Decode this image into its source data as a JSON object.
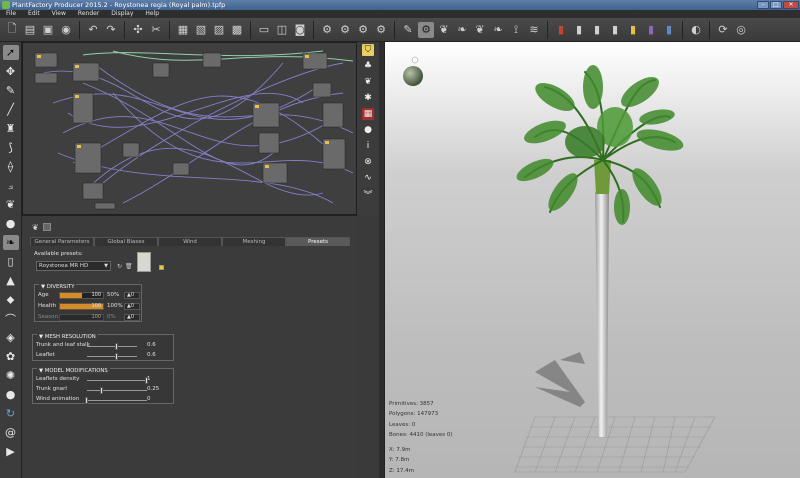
{
  "window": {
    "title": "PlantFactory Producer 2015.2 - Roystonea regia (Royal palm).tpfp",
    "min": "–",
    "max": "□",
    "close": "✕"
  },
  "menu": [
    "File",
    "Edit",
    "View",
    "Render",
    "Display",
    "Help"
  ],
  "panel": {
    "tabs": [
      "General Parameters",
      "Global Biases",
      "Wind",
      "Meshing",
      "Presets"
    ],
    "active_tab": "Presets",
    "presets_label": "Available presets:",
    "preset_value": "Roystonea MR HD",
    "diversity": {
      "title": "DIVERSITY",
      "rows": [
        {
          "label": "Age",
          "value": "50%",
          "max": "100",
          "spin": "0",
          "fill": 0.5,
          "enabled": true
        },
        {
          "label": "Health",
          "value": "100%",
          "max": "100",
          "spin": "0",
          "fill": 1.0,
          "enabled": true
        },
        {
          "label": "Season",
          "value": "0%",
          "max": "100",
          "spin": "0",
          "fill": 0.0,
          "enabled": false
        }
      ]
    },
    "mesh_resolution": {
      "title": "MESH RESOLUTION",
      "rows": [
        {
          "label": "Trunk and leaf stalk",
          "value": "0.6",
          "pos": 0.6
        },
        {
          "label": "Leaflet",
          "value": "0.6",
          "pos": 0.6
        }
      ]
    },
    "model_modifications": {
      "title": "MODEL MODIFICATIONS",
      "rows": [
        {
          "label": "Leaflets density",
          "value": "1",
          "pos": 1.0
        },
        {
          "label": "Trunk gnarl",
          "value": "0.25",
          "pos": 0.25
        },
        {
          "label": "Wind animation",
          "value": "0",
          "pos": 0.0
        }
      ]
    }
  },
  "stats": {
    "primitives": "Primitives: 3857",
    "polygons": "Polygons: 147973",
    "leaves": "Leaves: 0",
    "bones": "Bones: 4410 (leaves 0)"
  },
  "coords": {
    "x": "X: 7.9m",
    "y": "Y: 7.8m",
    "z": "Z: 17.4m"
  },
  "colors": {
    "accent_orange": "#d98b1f",
    "title_blue": "#3f6290",
    "palm_green": "#3f8a2a"
  }
}
